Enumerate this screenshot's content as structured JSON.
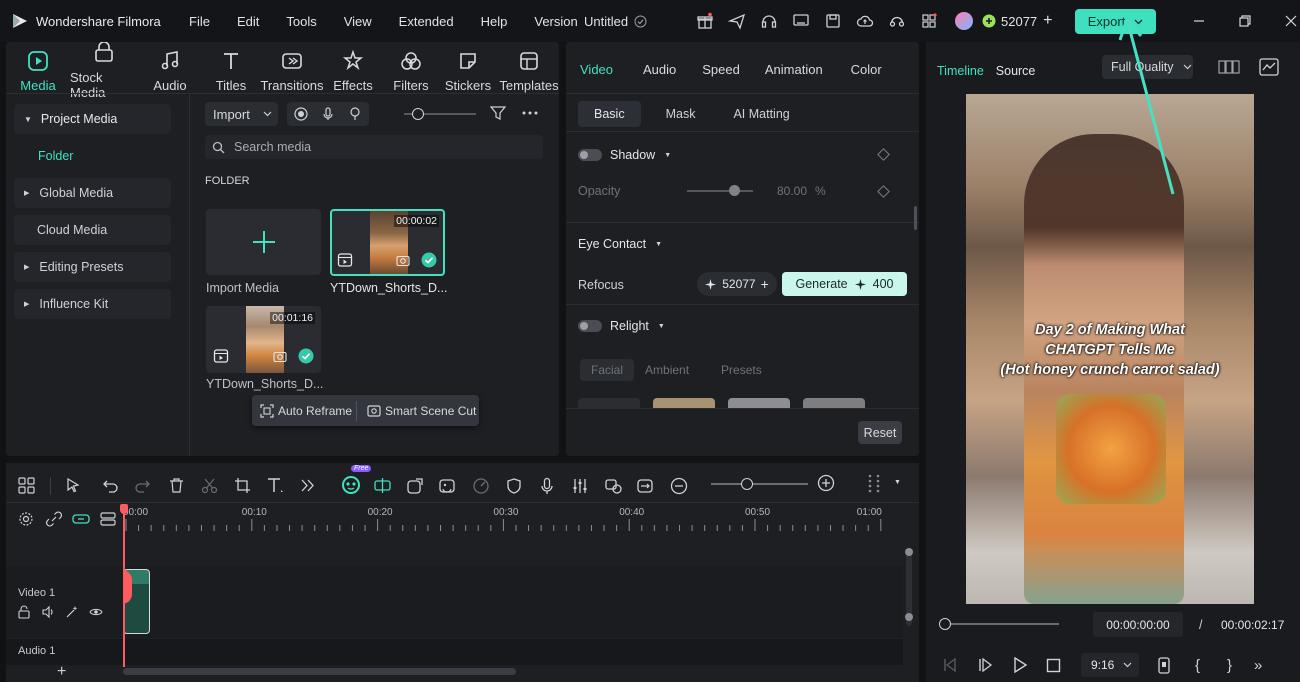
{
  "app": {
    "name": "Wondershare Filmora",
    "project_title": "Untitled",
    "credits": "52077",
    "export_label": "Export"
  },
  "menu": [
    "File",
    "Edit",
    "Tools",
    "View",
    "Extended",
    "Help",
    "Version"
  ],
  "toolbar": [
    {
      "label": "Media",
      "icon": "media-icon"
    },
    {
      "label": "Stock Media",
      "icon": "stock-media-icon"
    },
    {
      "label": "Audio",
      "icon": "audio-icon"
    },
    {
      "label": "Titles",
      "icon": "titles-icon"
    },
    {
      "label": "Transitions",
      "icon": "transitions-icon"
    },
    {
      "label": "Effects",
      "icon": "effects-icon"
    },
    {
      "label": "Filters",
      "icon": "filters-icon"
    },
    {
      "label": "Stickers",
      "icon": "stickers-icon"
    },
    {
      "label": "Templates",
      "icon": "templates-icon"
    }
  ],
  "sidebar": {
    "items": [
      {
        "label": "Project Media",
        "expanded": true
      },
      {
        "label": "Folder",
        "active": true
      },
      {
        "label": "Global Media"
      },
      {
        "label": "Cloud Media"
      },
      {
        "label": "Editing Presets"
      },
      {
        "label": "Influence Kit"
      }
    ]
  },
  "media": {
    "import_label": "Import",
    "search_placeholder": "Search media",
    "folder_label": "FOLDER",
    "import_tile_label": "Import Media",
    "clips": [
      {
        "name": "YTDown_Shorts_D...",
        "duration": "00:00:02"
      },
      {
        "name": "YTDown_Shorts_D...",
        "duration": "00:01:16"
      }
    ],
    "popup": {
      "auto_reframe": "Auto Reframe",
      "smart_scene_cut": "Smart Scene Cut"
    }
  },
  "properties": {
    "tabs": [
      "Video",
      "Audio",
      "Speed",
      "Animation",
      "Color"
    ],
    "subtabs": [
      "Basic",
      "Mask",
      "AI Matting"
    ],
    "shadow_label": "Shadow",
    "opacity_label": "Opacity",
    "opacity_value": "80.00",
    "opacity_unit": "%",
    "eye_contact_label": "Eye Contact",
    "refocus_label": "Refocus",
    "refocus_credits": "52077",
    "generate_label": "Generate",
    "generate_cost": "400",
    "relight_label": "Relight",
    "relight_tabs": [
      "Facial",
      "Ambient",
      "Presets"
    ],
    "reset_label": "Reset"
  },
  "preview": {
    "tabs": [
      "Timeline",
      "Source"
    ],
    "quality_label": "Full Quality",
    "caption_lines": [
      "Day 2 of Making What",
      "CHATGPT Tells Me",
      "(Hot honey crunch carrot salad)"
    ],
    "current_time": "00:00:00:00",
    "separator": "/",
    "total_time": "00:00:02:17",
    "aspect": "9:16",
    "progress": 0
  },
  "timeline": {
    "free_badge": "Free",
    "ticks": [
      "00:00",
      "00:10",
      "00:20",
      "00:30",
      "00:40",
      "00:50",
      "01:00"
    ],
    "tracks": [
      {
        "label": "Video 1"
      },
      {
        "label": "Audio 1"
      }
    ]
  },
  "colors": {
    "accent": "#41e2c2",
    "export_bg": "#3ee0c0",
    "playhead": "#ff5a5f"
  }
}
